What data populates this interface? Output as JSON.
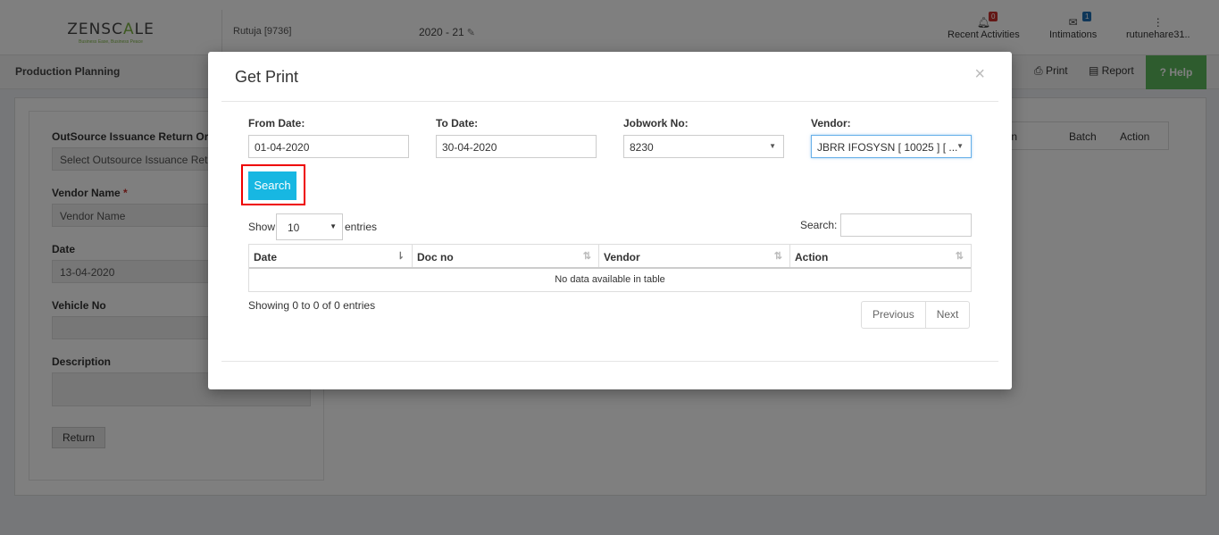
{
  "header": {
    "logo_main": "ZENSC",
    "logo_accent": "A",
    "logo_end": "LE",
    "logo_tagline": "Business Ease, Business Peace",
    "user": "Rutuja [9736]",
    "year": "2020 - 21",
    "recent_activities": {
      "label": "Recent Activities",
      "badge": "0"
    },
    "intimations": {
      "label": "Intimations",
      "badge": "1"
    },
    "account": {
      "label": "rutunehare31.."
    }
  },
  "subbar": {
    "title": "Production Planning",
    "print": "Print",
    "report": "Report",
    "help": "Help"
  },
  "form": {
    "outsource_label": "OutSource Issuance Return Order",
    "outsource_placeholder": "Select Outsource Issuance Return",
    "vendor_label": "Vendor Name",
    "vendor_required": "*",
    "vendor_placeholder": "Vendor Name",
    "date_label": "Date",
    "date_value": "13-04-2020",
    "vehicle_label": "Vehicle No",
    "description_label": "Description",
    "return_button": "Return"
  },
  "bg_table": {
    "columns": [
      "cation",
      "Batch",
      "Action"
    ]
  },
  "modal": {
    "title": "Get Print",
    "close": "×",
    "from_date_label": "From Date:",
    "from_date_value": "01-04-2020",
    "to_date_label": "To Date:",
    "to_date_value": "30-04-2020",
    "jobwork_label": "Jobwork No:",
    "jobwork_value": "8230",
    "vendor_label": "Vendor:",
    "vendor_value": "JBRR IFOSYSN [ 10025 ] [ ...",
    "search_button": "Search",
    "show_label": "Show",
    "length_value": "10",
    "entries_label": "entries",
    "search_label": "Search:",
    "table": {
      "columns": [
        "Date",
        "Doc no",
        "Vendor",
        "Action"
      ],
      "empty_message": "No data available in table"
    },
    "info": "Showing 0 to 0 of 0 entries",
    "previous": "Previous",
    "next": "Next"
  }
}
